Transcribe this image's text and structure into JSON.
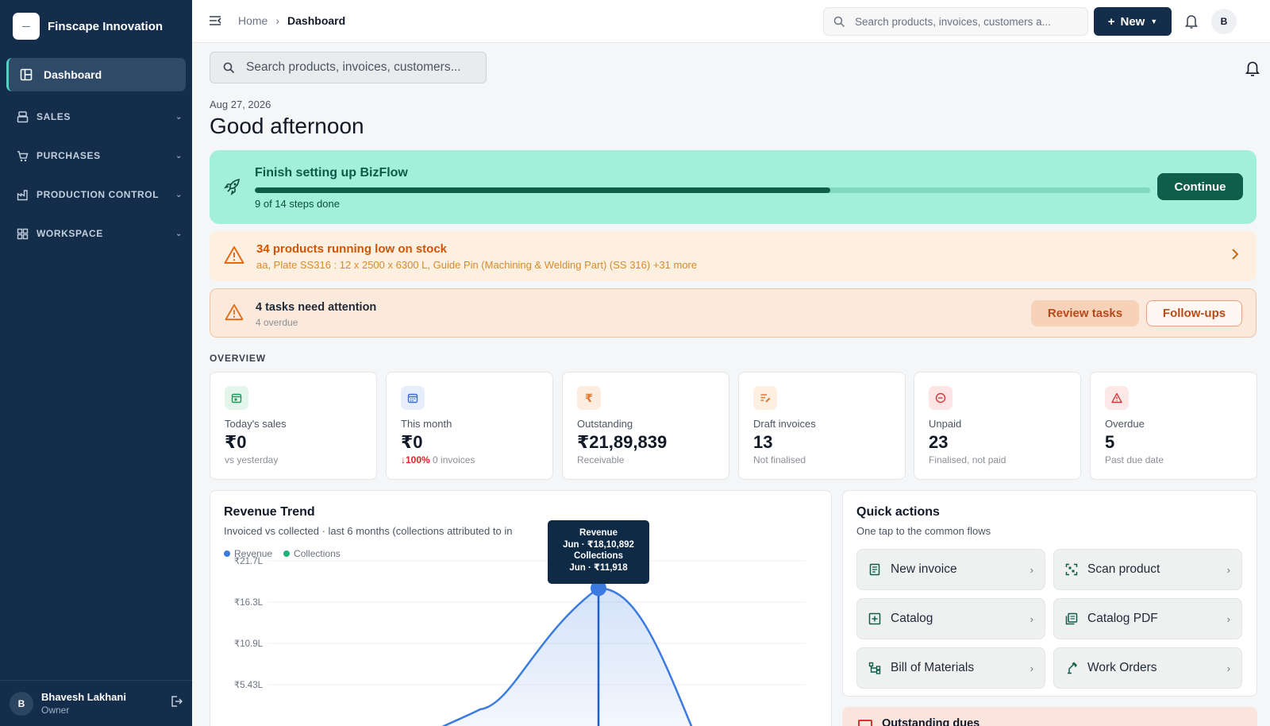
{
  "brand": {
    "name": "Finscape Innovation",
    "logo_text": "—"
  },
  "sidebar": {
    "active_item": "Dashboard",
    "groups": [
      {
        "label": "SALES",
        "icon": "sales-icon"
      },
      {
        "label": "PURCHASES",
        "icon": "cart-icon"
      },
      {
        "label": "PRODUCTION CONTROL",
        "icon": "factory-icon"
      },
      {
        "label": "WORKSPACE",
        "icon": "grid-icon"
      }
    ],
    "user": {
      "initial": "B",
      "name": "Bhavesh Lakhani",
      "role": "Owner"
    }
  },
  "topbar": {
    "breadcrumb": [
      "Home",
      "Dashboard"
    ],
    "search_placeholder": "Search products, invoices, customers a...",
    "new_label": "New",
    "avatar_initial": "B"
  },
  "main": {
    "search_placeholder": "Search products, invoices, customers...",
    "date": "Aug 27, 2026",
    "greeting": "Good afternoon"
  },
  "setup": {
    "title": "Finish setting up BizFlow",
    "steps_text": "9 of 14 steps done",
    "progress_fraction": 0.6428,
    "button": "Continue"
  },
  "low_stock": {
    "title": "34 products running low on stock",
    "items": "aa, Plate SS316 : 12 x 2500 x 6300 L, Guide Pin (Machining & Welding Part) (SS 316) +31 more"
  },
  "tasks": {
    "title": "4 tasks need attention",
    "sub": "4 overdue",
    "review_label": "Review tasks",
    "followups_label": "Follow-ups"
  },
  "overview": {
    "label": "OVERVIEW",
    "cards": [
      {
        "label": "Today's sales",
        "value": "₹0",
        "sub": "vs yesterday",
        "icon": "calendar-check-icon",
        "color": "#1d9a5b",
        "bg": "#e4f5ec"
      },
      {
        "label": "This month",
        "value": "₹0",
        "sub_arrow": "↓100%",
        "sub": "0 invoices",
        "icon": "calendar-icon",
        "color": "#3b6ed8",
        "bg": "#e6edfb"
      },
      {
        "label": "Outstanding",
        "value": "₹21,89,839",
        "sub": "Receivable",
        "icon": "rupee-icon",
        "color": "#e0782f",
        "bg": "#fdece0"
      },
      {
        "label": "Draft invoices",
        "value": "13",
        "sub": "Not finalised",
        "icon": "edit-list-icon",
        "color": "#e0782f",
        "bg": "#fdf0e0"
      },
      {
        "label": "Unpaid",
        "value": "23",
        "sub": "Finalised, not paid",
        "icon": "clock-icon",
        "color": "#d33b3b",
        "bg": "#fde5e5"
      },
      {
        "label": "Overdue",
        "value": "5",
        "sub": "Past due date",
        "icon": "alert-icon",
        "color": "#d33b3b",
        "bg": "#fde8e8"
      }
    ]
  },
  "revenue": {
    "title": "Revenue Trend",
    "subtitle": "Invoiced vs collected · last 6 months (collections attributed to in",
    "tooltip": {
      "l1": "Revenue",
      "l2": "Jun · ₹18,10,892",
      "l3": "Collections",
      "l4": "Jun · ₹11,918"
    }
  },
  "chart_data": {
    "type": "area",
    "title": "Revenue Trend",
    "series": [
      {
        "name": "Revenue",
        "color": "#3b7be0"
      },
      {
        "name": "Collections",
        "color": "#1fb37a"
      }
    ],
    "y_ticks": [
      "₹21.7L",
      "₹16.3L",
      "₹10.9L",
      "₹5.43L"
    ],
    "ylim": [
      0,
      2170000
    ],
    "highlight": {
      "month": "Jun",
      "revenue": 1810892,
      "collections": 11918
    }
  },
  "quick_actions": {
    "title": "Quick actions",
    "subtitle": "One tap to the common flows",
    "items": [
      {
        "label": "New invoice",
        "icon": "invoice-icon"
      },
      {
        "label": "Scan product",
        "icon": "qr-scan-icon"
      },
      {
        "label": "Catalog",
        "icon": "catalog-icon"
      },
      {
        "label": "Catalog PDF",
        "icon": "pdf-icon"
      },
      {
        "label": "Bill of Materials",
        "icon": "tree-icon"
      },
      {
        "label": "Work Orders",
        "icon": "wrench-icon"
      }
    ]
  },
  "dues": {
    "title": "Outstanding dues"
  }
}
